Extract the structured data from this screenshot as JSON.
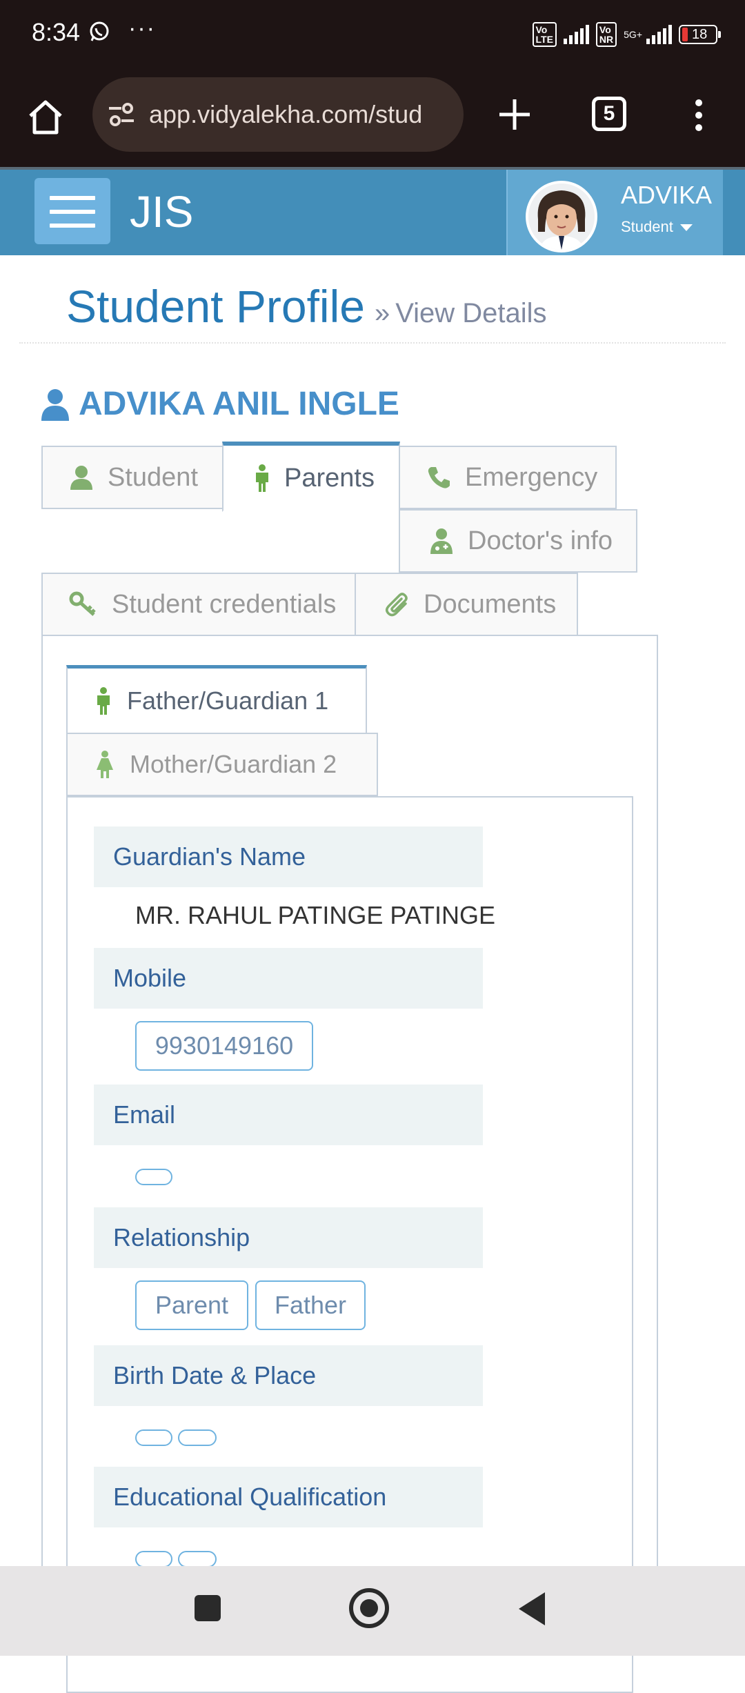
{
  "status_bar": {
    "time": "8:34",
    "battery": "18",
    "dots": "···"
  },
  "browser": {
    "url": "app.vidyalekha.com/stud",
    "tab_count": "5"
  },
  "app": {
    "brand": "JIS",
    "user_name": "ADVIKA",
    "user_role": "Student"
  },
  "page": {
    "title": "Student Profile",
    "raquo": "»",
    "subtitle": "View Details"
  },
  "student": {
    "name": "ADVIKA ANIL INGLE"
  },
  "tabs": {
    "student": "Student",
    "parents": "Parents",
    "emergency": "Emergency",
    "doctor": "Doctor's info",
    "credentials": "Student credentials",
    "documents": "Documents"
  },
  "subtabs": {
    "father": "Father/Guardian 1",
    "mother": "Mother/Guardian 2"
  },
  "fields": {
    "guardian_name_label": "Guardian's Name",
    "guardian_name_value": "MR. RAHUL PATINGE PATINGE",
    "mobile_label": "Mobile",
    "mobile_value": "9930149160",
    "email_label": "Email",
    "relationship_label": "Relationship",
    "relationship_values": [
      "Parent",
      "Father"
    ],
    "birth_label": "Birth Date & Place",
    "education_label": "Educational Qualification"
  },
  "colors": {
    "header_blue": "#438eb9",
    "title_blue": "#2679b5",
    "label_blue": "#336199",
    "icon_green": "#69aa46",
    "chip_border": "#6fb3e0"
  },
  "icons": {
    "home": "home-icon",
    "tune": "site-settings-icon",
    "plus": "plus-icon",
    "menu": "more-vert-icon",
    "user": "user-icon",
    "male": "male-icon",
    "female": "female-icon",
    "phone": "phone-icon",
    "doctor": "user-md-icon",
    "key": "key-icon",
    "paperclip": "paperclip-icon"
  }
}
